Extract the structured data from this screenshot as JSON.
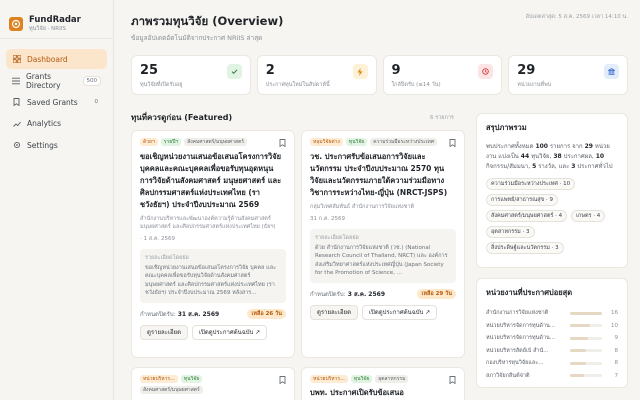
{
  "brand": {
    "name": "FundRadar",
    "subtitle": "ทุนวิจัย · NRIIS"
  },
  "nav": [
    {
      "label": "Dashboard",
      "badge": ""
    },
    {
      "label": "Grants Directory",
      "badge": "500"
    },
    {
      "label": "Saved Grants",
      "badge": "0"
    },
    {
      "label": "Analytics",
      "badge": ""
    },
    {
      "label": "Settings",
      "badge": ""
    }
  ],
  "header": {
    "title": "ภาพรวมทุนวิจัย (Overview)",
    "subtitle": "ข้อมูลอัปเดตอัตโนมัติจากประกาศ NRIIS ล่าสุด",
    "updated": "อัปเดตล่าสุด: 5 ส.ค. 2569 เวลา 14:10 น."
  },
  "stats": [
    {
      "value": "25",
      "label": "ทุนวิจัยที่เปิดรับอยู่",
      "icon": "check-icon",
      "color": "#2d7a37",
      "bg": "#e1f3e2"
    },
    {
      "value": "2",
      "label": "ประกาศทุนใหม่ในสัปดาห์นี้",
      "icon": "bolt-icon",
      "color": "#d98e12",
      "bg": "#fdf1d8"
    },
    {
      "value": "9",
      "label": "ใกล้ปิดรับ (≤14 วัน)",
      "icon": "clock-icon",
      "color": "#d33b3b",
      "bg": "#fde4e4"
    },
    {
      "value": "29",
      "label": "หน่วยงานที่พบ",
      "icon": "bank-icon",
      "color": "#3b6fd1",
      "bg": "#e3ecfb"
    }
  ],
  "featured": {
    "title": "ทุนที่ควรดูก่อน (Featured)",
    "count": "6 รายการ",
    "cards": [
      {
        "tags": [
          {
            "text": "ด้วยฯ",
            "kind": "cat"
          },
          {
            "text": "รายปีฯ",
            "kind": "type"
          },
          {
            "text": "สังคมศาสตร์/มนุษยศาสตร์",
            "kind": "org"
          }
        ],
        "title": "ขอเชิญหน่วยงานเสนอข้อเสนอโครงการวิจัย บุคคลและคณะบุคคลเพื่อขอรับทุนอุดหนุนการวิจัยด้านสังคมศาสตร์ มนุษยศาสตร์ และศิลปกรรมศาสตร์แห่งประเทศไทย (ราชวังธัยฯ) ประจำปีงบประมาณ 2569",
        "org": "สำนักงานบริหารและพัฒนาองค์ความรู้ด้านสังคมศาสตร์ มนุษยศาสตร์ และศิลปกรรมศาสตร์แห่งประเทศไทย (ธัยฯ)",
        "date": "1 ส.ค. 2569",
        "desc_head": "รายละเอียดโดยย่อ",
        "desc": "ขอเชิญหน่วยงานเสนอข้อเสนอโครงการวิจัย บุคคล และคณะบุคคลเพื่อขอรับทุนวิจัยด้านสังคมศาสตร์ มนุษยศาสตร์ และศิลปกรรมศาสตร์แห่งประเทศไทย (ราชวังธัยฯ) ประจำปีงบประมาณ 2569 หลังสาร...",
        "deadline_label": "กำหนดปิดรับ:",
        "deadline": "31 ส.ค. 2569",
        "days_left": "เหลือ 26 วัน",
        "btn_detail": "ดูรายละเอียด",
        "btn_open": "เปิดดูประกาศต้นฉบับ ↗"
      },
      {
        "tags": [
          {
            "text": "หลุมวิจัยต่าง",
            "kind": "cat"
          },
          {
            "text": "ทุนวิจัย",
            "kind": "type"
          },
          {
            "text": "ความร่วมมือระหว่างประเทศ",
            "kind": "org"
          }
        ],
        "title": "วช. ประกาศรับข้อเสนอการวิจัยและนวัตกรรม ประจำปีงบประมาณ 2570 ทุนวิจัยและนวัตกรรมภายใต้ความร่วมมือทางวิชาการระหว่างไทย-ญี่ปุ่น (NRCT-JSPS)",
        "org": "กลุ่มวิเทศสัมพันธ์ สำนักงานการวิจัยแห่งชาติ",
        "date": "31 ก.ค. 2569",
        "desc_head": "รายละเอียดโดยย่อ",
        "desc": "ด้วย สำนักงานการวิจัยแห่งชาติ (วช.) (National Research Council of Thailand, NRCT) และ องค์การส่งเสริมวิทยาศาสตร์แห่งประเทศญี่ปุ่น (Japan Society for the Promotion of Science, ...",
        "deadline_label": "กำหนดปิดรับ:",
        "deadline": "3 ส.ค. 2569",
        "days_left": "เหลือ 29 วัน",
        "btn_detail": "ดูรายละเอียด",
        "btn_open": "เปิดดูประกาศต้นฉบับ ↗"
      },
      {
        "tags": [
          {
            "text": "หน่วยบริหาร...",
            "kind": "cat"
          },
          {
            "text": "ทุนวิจัย",
            "kind": "type"
          },
          {
            "text": "สังคมศาสตร์/มนุษยศาสตร์",
            "kind": "org"
          }
        ]
      },
      {
        "tags": [
          {
            "text": "หน่วยบริหาร...",
            "kind": "cat"
          },
          {
            "text": "ทุนวิจัย",
            "kind": "type"
          },
          {
            "text": "อุตสาหกรรม",
            "kind": "org"
          }
        ],
        "title": "บพท. ประกาศเปิดรับข้อเสนอ"
      }
    ]
  },
  "summary": {
    "title": "สรุปภาพรวม",
    "text_a": "พบประกาศทั้งหมด",
    "total": "100",
    "text_b": "รายการ จาก",
    "agencies": "29",
    "text_c": "หน่วยงาน แบ่งเป็น",
    "grants": "44",
    "text_d": "ทุนวิจัย,",
    "awards": "38",
    "text_e": "ประกาศผล,",
    "others": "10",
    "text_f": "กิจกรรม/สัมมนา,",
    "more1": "5",
    "text_g": "รางวัล, และ",
    "more2": "3",
    "text_h": "ประกาศทั่วไป",
    "chips": [
      "ความร่วมมือระหว่างประเทศ · 10",
      "การแพทย์/สาธารณสุข · 9",
      "สังคมศาสตร์/มนุษยศาสตร์ · 4",
      "เกษตร · 4",
      "อุตสาหกรรม · 3",
      "สิ่งประดิษฐ์และนวัตกรรม · 3"
    ]
  },
  "agency_panel": {
    "title": "หน่วยงานที่ประกาศบ่อยสุด",
    "rows": [
      {
        "name": "สำนักงานการวิจัยแห่งชาติ",
        "count": 16
      },
      {
        "name": "หน่วยบริหารจัดการทุนด้าน...",
        "count": 10
      },
      {
        "name": "หน่วยบริหารจัดการทุนด้าน...",
        "count": 9
      },
      {
        "name": "หน่วยบริหารสัตย์เบ้ สำนั...",
        "count": 8
      },
      {
        "name": "กองบริหารทุนวิจัยและ...",
        "count": 8
      },
      {
        "name": "สภาวิจัยกลีนต์จ่าติ",
        "count": 7
      }
    ]
  }
}
